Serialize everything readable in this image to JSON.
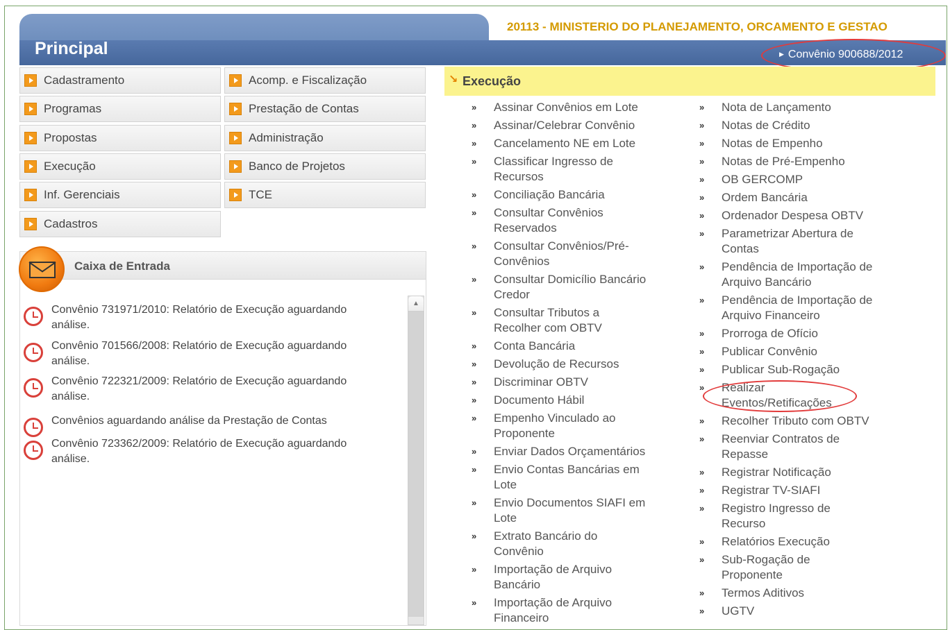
{
  "header": {
    "title": "Principal",
    "org": "20113 - MINISTERIO DO PLANEJAMENTO, ORCAMENTO E GESTAO",
    "convenio_link": "Convênio 900688/2012"
  },
  "menu": [
    "Cadastramento",
    "Acomp. e Fiscalização",
    "Programas",
    "Prestação de Contas",
    "Propostas",
    "Administração",
    "Execução",
    "Banco de Projetos",
    "Inf. Gerenciais",
    "TCE",
    "Cadastros"
  ],
  "inbox": {
    "title": "Caixa de Entrada",
    "items": [
      [
        "Convênio 731971/2010: Relatório de Execução aguardando",
        "análise."
      ],
      [
        "Convênio 701566/2008: Relatório de Execução aguardando",
        "análise."
      ],
      [
        "Convênio 722321/2009: Relatório de Execução aguardando",
        "análise."
      ],
      [
        "Convênios aguardando análise da Prestação de Contas",
        ""
      ],
      [
        "Convênio 723362/2009: Relatório de Execução aguardando",
        "análise."
      ]
    ]
  },
  "execution": {
    "title": "Execução",
    "bullet": "»",
    "left": [
      [
        "Assinar Convênios em Lote"
      ],
      [
        "Assinar/Celebrar Convênio"
      ],
      [
        "Cancelamento NE em Lote"
      ],
      [
        "Classificar Ingresso de",
        "Recursos"
      ],
      [
        "Conciliação Bancária"
      ],
      [
        "Consultar Convênios",
        "Reservados"
      ],
      [
        "Consultar Convênios/Pré-",
        "Convênios"
      ],
      [
        "Consultar Domicílio Bancário",
        "Credor"
      ],
      [
        "Consultar Tributos a",
        "Recolher com OBTV"
      ],
      [
        "Conta Bancária"
      ],
      [
        "Devolução de Recursos"
      ],
      [
        "Discriminar OBTV"
      ],
      [
        "Documento Hábil"
      ],
      [
        "Empenho Vinculado ao",
        "Proponente"
      ],
      [
        "Enviar Dados Orçamentários"
      ],
      [
        "Envio Contas Bancárias em",
        "Lote"
      ],
      [
        "Envio Documentos SIAFI em",
        "Lote"
      ],
      [
        "Extrato Bancário do",
        "Convênio"
      ],
      [
        "Importação de Arquivo",
        "Bancário"
      ],
      [
        "Importação de Arquivo",
        "Financeiro"
      ]
    ],
    "right": [
      [
        "Nota de Lançamento"
      ],
      [
        "Notas de Crédito"
      ],
      [
        "Notas de Empenho"
      ],
      [
        "Notas de Pré-Empenho"
      ],
      [
        "OB GERCOMP"
      ],
      [
        "Ordem Bancária"
      ],
      [
        "Ordenador Despesa OBTV"
      ],
      [
        "Parametrizar Abertura de",
        "Contas"
      ],
      [
        "Pendência de Importação de",
        "Arquivo Bancário"
      ],
      [
        "Pendência de Importação de",
        "Arquivo Financeiro"
      ],
      [
        "Prorroga de Ofício"
      ],
      [
        "Publicar Convênio"
      ],
      [
        "Publicar Sub-Rogação"
      ],
      [
        "Realizar",
        "Eventos/Retificações"
      ],
      [
        "Recolher Tributo com OBTV"
      ],
      [
        "Reenviar Contratos de",
        "Repasse"
      ],
      [
        "Registrar Notificação"
      ],
      [
        "Registrar TV-SIAFI"
      ],
      [
        "Registro Ingresso de",
        "Recurso"
      ],
      [
        "Relatórios Execução"
      ],
      [
        "Sub-Rogação de",
        "Proponente"
      ],
      [
        "Termos Aditivos"
      ],
      [
        "UGTV"
      ]
    ]
  },
  "colors": {
    "header_blue": "#4f71a8",
    "org_gold": "#d49a00",
    "exec_yellow": "#fbf38e",
    "menu_icon_orange": "#f39a1c",
    "annotation_red": "#e23b3b"
  }
}
